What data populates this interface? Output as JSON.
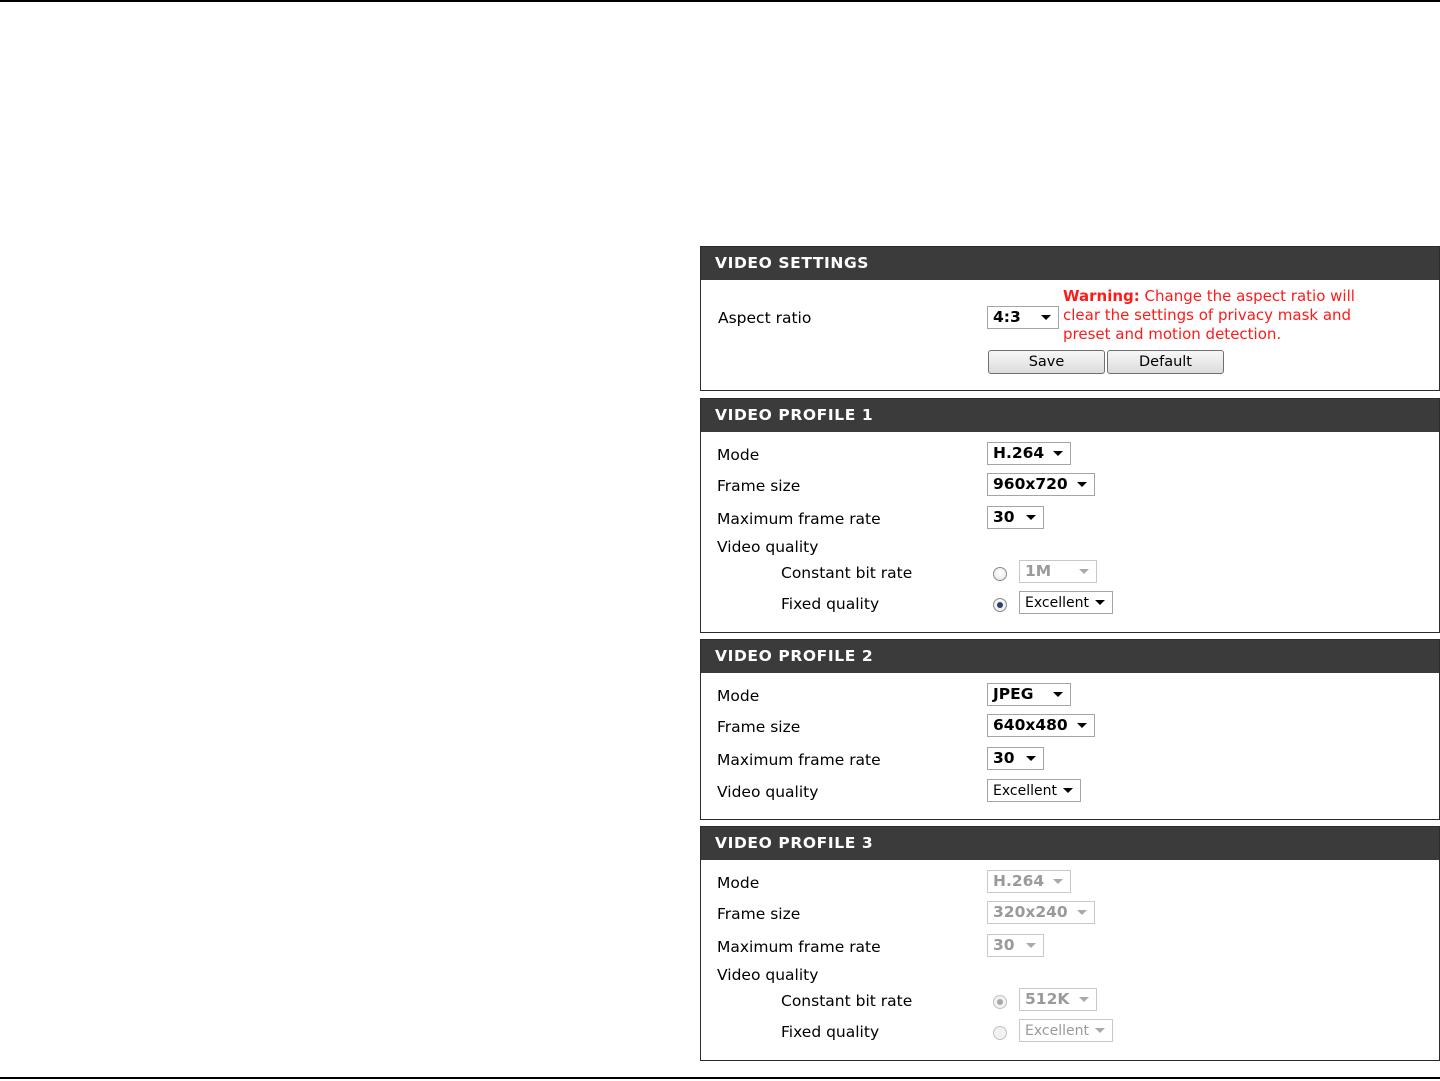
{
  "video_settings": {
    "title": "VIDEO SETTINGS",
    "aspect_ratio_label": "Aspect ratio",
    "aspect_ratio_value": "4:3",
    "warning_label": "Warning:",
    "warning_text": "Change the aspect ratio will clear the settings of privacy mask and preset and motion detection.",
    "save_label": "Save",
    "default_label": "Default"
  },
  "profile1": {
    "title": "VIDEO PROFILE 1",
    "mode_label": "Mode",
    "mode_value": "H.264",
    "frame_size_label": "Frame size",
    "frame_size_value": "960x720",
    "max_frame_rate_label": "Maximum frame rate",
    "max_frame_rate_value": "30",
    "video_quality_label": "Video quality",
    "cbr_label": "Constant bit rate",
    "cbr_value": "1M",
    "fixed_quality_label": "Fixed quality",
    "fixed_quality_value": "Excellent",
    "selected_quality": "fixed"
  },
  "profile2": {
    "title": "VIDEO PROFILE 2",
    "mode_label": "Mode",
    "mode_value": "JPEG",
    "frame_size_label": "Frame size",
    "frame_size_value": "640x480",
    "max_frame_rate_label": "Maximum frame rate",
    "max_frame_rate_value": "30",
    "video_quality_label": "Video quality",
    "video_quality_value": "Excellent"
  },
  "profile3": {
    "title": "VIDEO PROFILE 3",
    "mode_label": "Mode",
    "mode_value": "H.264",
    "frame_size_label": "Frame size",
    "frame_size_value": "320x240",
    "max_frame_rate_label": "Maximum frame rate",
    "max_frame_rate_value": "30",
    "video_quality_label": "Video quality",
    "cbr_label": "Constant bit rate",
    "cbr_value": "512K",
    "fixed_quality_label": "Fixed quality",
    "fixed_quality_value": "Excellent",
    "selected_quality": "cbr",
    "disabled": true
  },
  "colors": {
    "header_bg": "#3b3b3b",
    "warning": "#ff1a1a",
    "border": "#2b2b2b"
  }
}
